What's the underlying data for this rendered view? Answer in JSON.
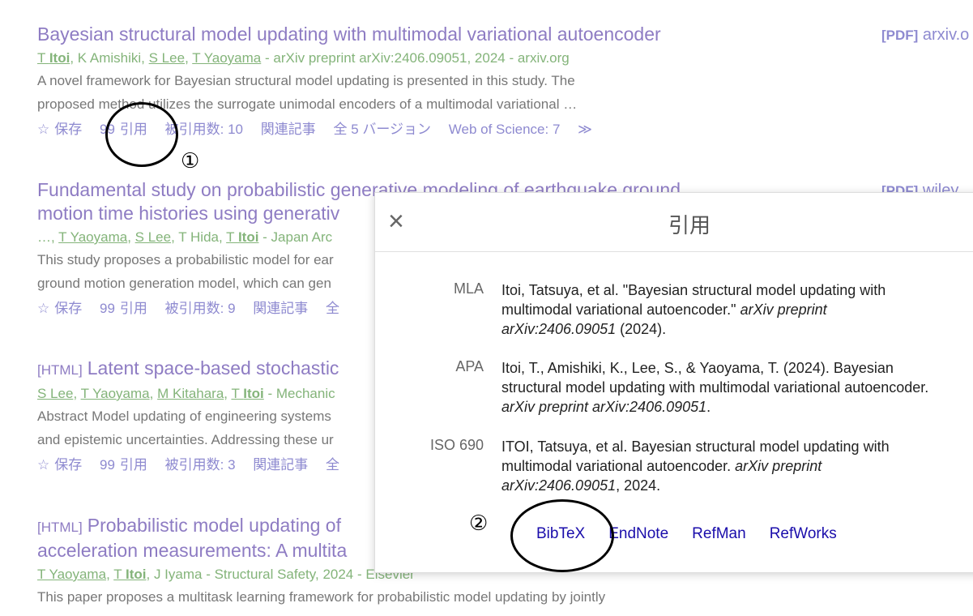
{
  "results": [
    {
      "title": "Bayesian structural model updating with multimodal variational autoencoder",
      "authors": [
        {
          "name": "T ",
          "bold": "Itoi",
          "link": true
        },
        {
          "sep": ", "
        },
        {
          "name": "K Amishiki",
          "link": false
        },
        {
          "sep": ", "
        },
        {
          "name": "S Lee",
          "link": true
        },
        {
          "sep": ", "
        },
        {
          "name": "T Yaoyama",
          "link": true
        }
      ],
      "source": " - arXiv preprint arXiv:2406.09051, 2024 - arxiv.org",
      "snippet": [
        "A novel framework for Bayesian structural model updating is presented in this study. The",
        "proposed method utilizes the surrogate unimodal encoders of a multimodal variational …"
      ],
      "actions": {
        "save": "保存",
        "cite": "引用",
        "cited": "被引用数: 10",
        "related": "関連記事",
        "versions": "全 5 バージョン",
        "wos": "Web of Science: 7",
        "more": "≫"
      },
      "side": {
        "tag": "[PDF]",
        "domain": " arxiv.o"
      }
    },
    {
      "title_line1": "Fundamental study on probabilistic generative modeling of earthquake ground",
      "title_line2": "motion time histories using generativ",
      "authors_text": "…, ",
      "source": " - Japan Arc",
      "snippet": [
        "This study proposes a probabilistic model for ear",
        "ground motion generation model, which can gen"
      ],
      "actions": {
        "save": "保存",
        "cite": "引用",
        "cited": "被引用数: 9",
        "related": "関連記事",
        "versions": "全"
      },
      "side": {
        "tag": "[PDF]",
        "domain": " wiley"
      }
    },
    {
      "tag": "[HTML]",
      "title": "Latent space-based stochastic",
      "source": " - Mechanic",
      "snippet": [
        "Abstract Model updating of engineering systems",
        "and epistemic uncertainties. Addressing these ur"
      ],
      "actions": {
        "save": "保存",
        "cite": "引用",
        "cited": "被引用数: 3",
        "related": "関連記事",
        "versions": "全"
      }
    },
    {
      "tag": "[HTML]",
      "title_line1": "Probabilistic model updating of",
      "title_line2": "acceleration measurements: A multita",
      "source": " - Structural Safety, 2024 - Elsevier",
      "snippet": [
        "This paper proposes a multitask learning framework for probabilistic model updating by jointly"
      ]
    }
  ],
  "icons": {
    "save": "star-icon",
    "cite": "quote-icon",
    "more": "double-chevron-icon"
  },
  "annotations": {
    "one": "①",
    "two": "②"
  },
  "dialog": {
    "close": "×",
    "title": "引用",
    "citations": [
      {
        "label": "MLA",
        "parts": [
          {
            "t": "Itoi, Tatsuya, et al. \"Bayesian structural model updating with multimodal variational autoencoder.\" "
          },
          {
            "i": "arXiv preprint arXiv:2406.09051"
          },
          {
            "t": " (2024)."
          }
        ]
      },
      {
        "label": "APA",
        "parts": [
          {
            "t": "Itoi, T., Amishiki, K., Lee, S., & Yaoyama, T. (2024). Bayesian structural model updating with multimodal variational autoencoder. "
          },
          {
            "i": "arXiv preprint arXiv:2406.09051"
          },
          {
            "t": "."
          }
        ]
      },
      {
        "label": "ISO 690",
        "parts": [
          {
            "t": "ITOI, Tatsuya, et al. Bayesian structural model updating with multimodal variational autoencoder. "
          },
          {
            "i": "arXiv preprint arXiv:2406.09051"
          },
          {
            "t": ", 2024."
          }
        ]
      }
    ],
    "links": [
      "BibTeX",
      "EndNote",
      "RefMan",
      "RefWorks"
    ]
  },
  "colors": {
    "title": "#8e7cc3",
    "author": "#84b47a",
    "action": "#8e8ad0",
    "link": "#1a0dab"
  }
}
